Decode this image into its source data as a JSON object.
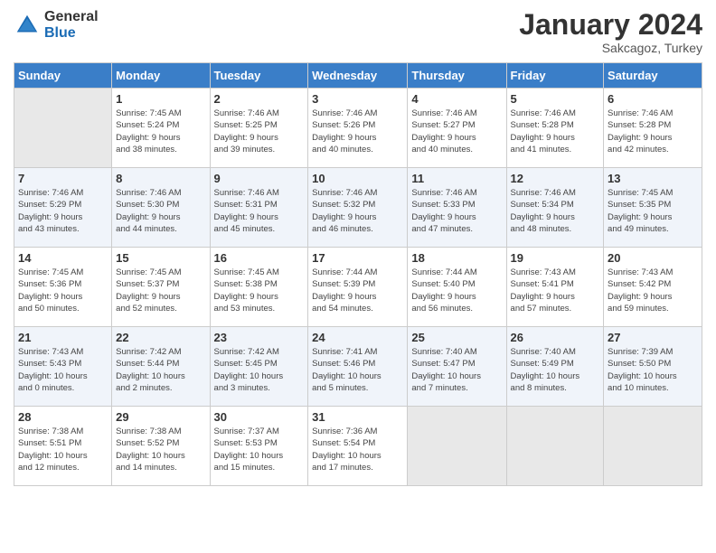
{
  "header": {
    "logo_line1": "General",
    "logo_line2": "Blue",
    "month": "January 2024",
    "location": "Sakcagoz, Turkey"
  },
  "days_of_week": [
    "Sunday",
    "Monday",
    "Tuesday",
    "Wednesday",
    "Thursday",
    "Friday",
    "Saturday"
  ],
  "weeks": [
    [
      {
        "day": "",
        "info": ""
      },
      {
        "day": "1",
        "info": "Sunrise: 7:45 AM\nSunset: 5:24 PM\nDaylight: 9 hours\nand 38 minutes."
      },
      {
        "day": "2",
        "info": "Sunrise: 7:46 AM\nSunset: 5:25 PM\nDaylight: 9 hours\nand 39 minutes."
      },
      {
        "day": "3",
        "info": "Sunrise: 7:46 AM\nSunset: 5:26 PM\nDaylight: 9 hours\nand 40 minutes."
      },
      {
        "day": "4",
        "info": "Sunrise: 7:46 AM\nSunset: 5:27 PM\nDaylight: 9 hours\nand 40 minutes."
      },
      {
        "day": "5",
        "info": "Sunrise: 7:46 AM\nSunset: 5:28 PM\nDaylight: 9 hours\nand 41 minutes."
      },
      {
        "day": "6",
        "info": "Sunrise: 7:46 AM\nSunset: 5:28 PM\nDaylight: 9 hours\nand 42 minutes."
      }
    ],
    [
      {
        "day": "7",
        "info": "Sunrise: 7:46 AM\nSunset: 5:29 PM\nDaylight: 9 hours\nand 43 minutes."
      },
      {
        "day": "8",
        "info": "Sunrise: 7:46 AM\nSunset: 5:30 PM\nDaylight: 9 hours\nand 44 minutes."
      },
      {
        "day": "9",
        "info": "Sunrise: 7:46 AM\nSunset: 5:31 PM\nDaylight: 9 hours\nand 45 minutes."
      },
      {
        "day": "10",
        "info": "Sunrise: 7:46 AM\nSunset: 5:32 PM\nDaylight: 9 hours\nand 46 minutes."
      },
      {
        "day": "11",
        "info": "Sunrise: 7:46 AM\nSunset: 5:33 PM\nDaylight: 9 hours\nand 47 minutes."
      },
      {
        "day": "12",
        "info": "Sunrise: 7:46 AM\nSunset: 5:34 PM\nDaylight: 9 hours\nand 48 minutes."
      },
      {
        "day": "13",
        "info": "Sunrise: 7:45 AM\nSunset: 5:35 PM\nDaylight: 9 hours\nand 49 minutes."
      }
    ],
    [
      {
        "day": "14",
        "info": "Sunrise: 7:45 AM\nSunset: 5:36 PM\nDaylight: 9 hours\nand 50 minutes."
      },
      {
        "day": "15",
        "info": "Sunrise: 7:45 AM\nSunset: 5:37 PM\nDaylight: 9 hours\nand 52 minutes."
      },
      {
        "day": "16",
        "info": "Sunrise: 7:45 AM\nSunset: 5:38 PM\nDaylight: 9 hours\nand 53 minutes."
      },
      {
        "day": "17",
        "info": "Sunrise: 7:44 AM\nSunset: 5:39 PM\nDaylight: 9 hours\nand 54 minutes."
      },
      {
        "day": "18",
        "info": "Sunrise: 7:44 AM\nSunset: 5:40 PM\nDaylight: 9 hours\nand 56 minutes."
      },
      {
        "day": "19",
        "info": "Sunrise: 7:43 AM\nSunset: 5:41 PM\nDaylight: 9 hours\nand 57 minutes."
      },
      {
        "day": "20",
        "info": "Sunrise: 7:43 AM\nSunset: 5:42 PM\nDaylight: 9 hours\nand 59 minutes."
      }
    ],
    [
      {
        "day": "21",
        "info": "Sunrise: 7:43 AM\nSunset: 5:43 PM\nDaylight: 10 hours\nand 0 minutes."
      },
      {
        "day": "22",
        "info": "Sunrise: 7:42 AM\nSunset: 5:44 PM\nDaylight: 10 hours\nand 2 minutes."
      },
      {
        "day": "23",
        "info": "Sunrise: 7:42 AM\nSunset: 5:45 PM\nDaylight: 10 hours\nand 3 minutes."
      },
      {
        "day": "24",
        "info": "Sunrise: 7:41 AM\nSunset: 5:46 PM\nDaylight: 10 hours\nand 5 minutes."
      },
      {
        "day": "25",
        "info": "Sunrise: 7:40 AM\nSunset: 5:47 PM\nDaylight: 10 hours\nand 7 minutes."
      },
      {
        "day": "26",
        "info": "Sunrise: 7:40 AM\nSunset: 5:49 PM\nDaylight: 10 hours\nand 8 minutes."
      },
      {
        "day": "27",
        "info": "Sunrise: 7:39 AM\nSunset: 5:50 PM\nDaylight: 10 hours\nand 10 minutes."
      }
    ],
    [
      {
        "day": "28",
        "info": "Sunrise: 7:38 AM\nSunset: 5:51 PM\nDaylight: 10 hours\nand 12 minutes."
      },
      {
        "day": "29",
        "info": "Sunrise: 7:38 AM\nSunset: 5:52 PM\nDaylight: 10 hours\nand 14 minutes."
      },
      {
        "day": "30",
        "info": "Sunrise: 7:37 AM\nSunset: 5:53 PM\nDaylight: 10 hours\nand 15 minutes."
      },
      {
        "day": "31",
        "info": "Sunrise: 7:36 AM\nSunset: 5:54 PM\nDaylight: 10 hours\nand 17 minutes."
      },
      {
        "day": "",
        "info": ""
      },
      {
        "day": "",
        "info": ""
      },
      {
        "day": "",
        "info": ""
      }
    ]
  ]
}
